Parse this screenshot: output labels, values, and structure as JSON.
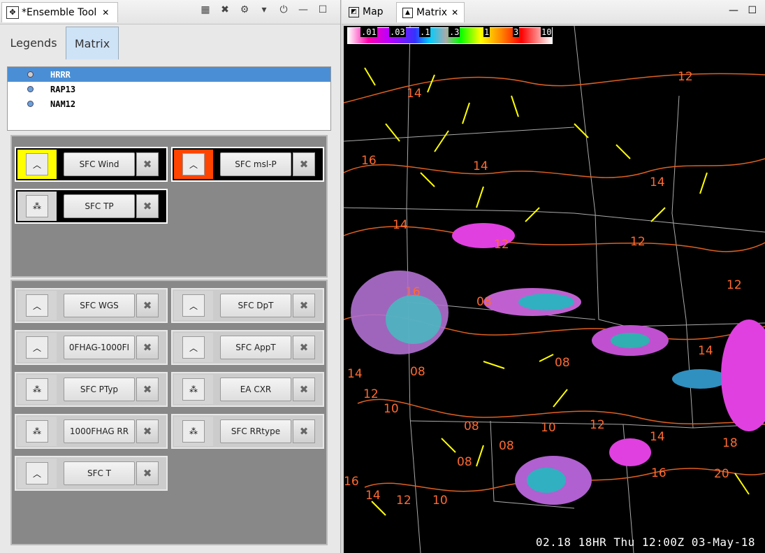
{
  "left_view": {
    "title": "*Ensemble Tool",
    "tabs": [
      "Legends",
      "Matrix"
    ],
    "models": [
      "HRRR",
      "RAP13",
      "NAM12"
    ],
    "active_cards": [
      {
        "label": "SFC Wind",
        "swatch": "#ffff00",
        "icon": "chevron-up-icon"
      },
      {
        "label": "SFC msl-P",
        "swatch": "#ff4400",
        "icon": "chevron-up-icon"
      },
      {
        "label": "SFC TP",
        "swatch": "#d4d4d4",
        "icon": "dots-icon"
      }
    ],
    "cards": [
      {
        "label": "SFC WGS",
        "icon": "chevron-up-icon"
      },
      {
        "label": "SFC DpT",
        "icon": "chevron-up-icon"
      },
      {
        "label": "0FHAG-1000FI",
        "icon": "chevron-up-icon"
      },
      {
        "label": "SFC AppT",
        "icon": "chevron-up-icon"
      },
      {
        "label": "SFC PTyp",
        "icon": "stars-icon"
      },
      {
        "label": "EA CXR",
        "icon": "dots-icon"
      },
      {
        "label": "1000FHAG RR",
        "icon": "dots-icon"
      },
      {
        "label": "SFC RRtype",
        "icon": "dots-icon"
      },
      {
        "label": "SFC T",
        "icon": "chevron-up-icon"
      }
    ]
  },
  "right_view": {
    "tabs": [
      "Map",
      "Matrix"
    ],
    "colorbar_labels": [
      ".01",
      ".03",
      ".1",
      ".3",
      "1",
      "3",
      "10"
    ],
    "status": "02.18   18HR Thu 12:00Z 03-May-18"
  }
}
